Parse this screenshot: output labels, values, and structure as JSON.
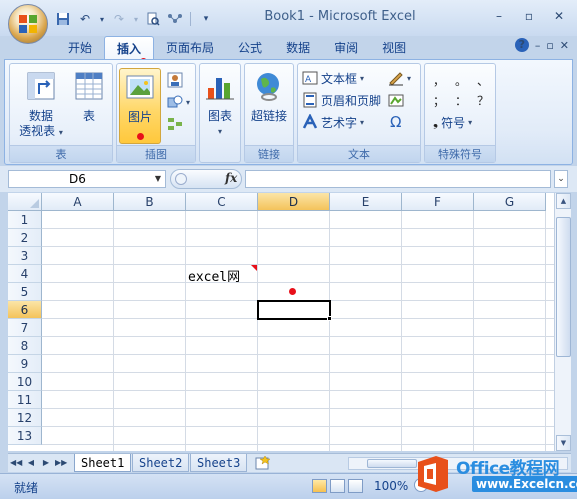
{
  "window": {
    "title": "Book1 - Microsoft Excel",
    "minimize": "–",
    "restore": "▫",
    "close": "✕"
  },
  "qat": {
    "save": "💾",
    "undo": "↶",
    "undo_dd": "▾",
    "redo": "↷",
    "redo_dd": "▾",
    "preview": "🔍",
    "shapes": "⋯",
    "customize": "▾"
  },
  "ribbon_tabs": [
    "开始",
    "插入",
    "页面布局",
    "公式",
    "数据",
    "审阅",
    "视图"
  ],
  "active_tab": "插入",
  "tab_right": {
    "help": "?",
    "min": "–",
    "restore": "▫",
    "close": "✕"
  },
  "groups": {
    "tables": {
      "label": "表",
      "pivot_line1": "数据",
      "pivot_line2": "透视表",
      "table": "表"
    },
    "illustrations": {
      "label": "插图",
      "picture": "图片"
    },
    "charts": {
      "label": "",
      "chart": "图表"
    },
    "links": {
      "label": "链接",
      "hyperlink": "超链接"
    },
    "text": {
      "label": "文本",
      "textbox": "文本框",
      "header_footer": "页眉和页脚",
      "wordart": "艺术字",
      "omega": "Ω"
    },
    "special": {
      "label": "特殊符号",
      "symbols": [
        "，",
        "。",
        "、",
        "；",
        "：",
        "？"
      ],
      "symbol_btn": "符号",
      "symbol_bullet": "❟"
    }
  },
  "formula_bar": {
    "name_box": "D6",
    "fx": "fx",
    "formula": ""
  },
  "columns": [
    "A",
    "B",
    "C",
    "D",
    "E",
    "F",
    "G"
  ],
  "rows": [
    "1",
    "2",
    "3",
    "4",
    "5",
    "6",
    "7",
    "8",
    "9",
    "10",
    "11",
    "12",
    "13"
  ],
  "selected_col": "D",
  "selected_row": "6",
  "cells": {
    "C4": "excel网"
  },
  "sheets": [
    "Sheet1",
    "Sheet2",
    "Sheet3"
  ],
  "active_sheet": "Sheet1",
  "sheet_nav": [
    "◀◀",
    "◀",
    "▶",
    "▶▶"
  ],
  "status": {
    "ready": "就绪",
    "zoom": "100%",
    "zoom_out": "–"
  },
  "watermark": {
    "line1": "Office教程网",
    "line2": "www.Excelcn.com"
  }
}
